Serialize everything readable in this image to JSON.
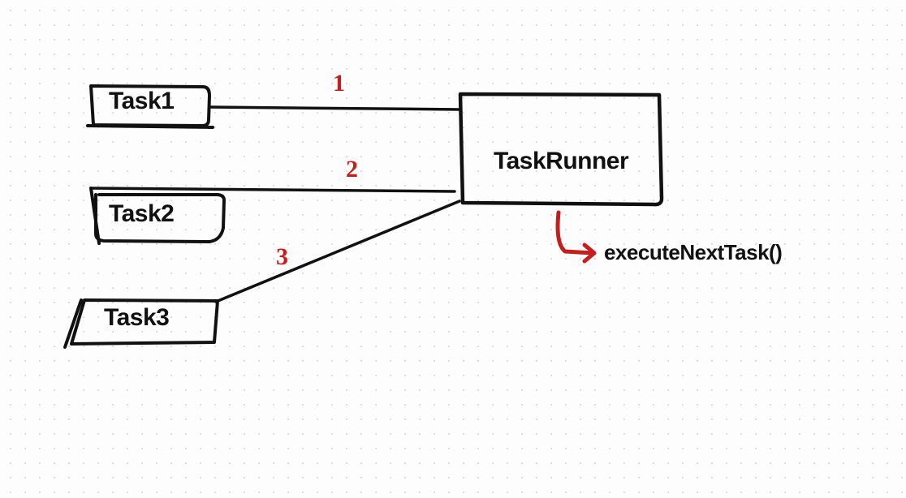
{
  "tasks": [
    {
      "label": "Task1",
      "order": "1"
    },
    {
      "label": "Task2",
      "order": "2"
    },
    {
      "label": "Task3",
      "order": "3"
    }
  ],
  "runner": {
    "label": "TaskRunner",
    "method": "executeNextTask()"
  }
}
